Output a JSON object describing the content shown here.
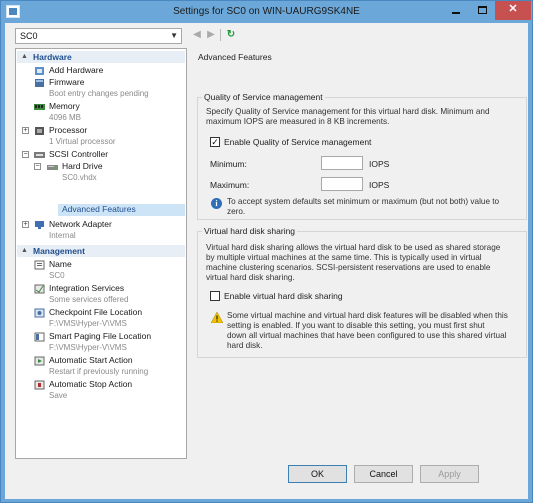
{
  "window": {
    "title": "Settings for SC0 on WIN-UAURG9SK4NE",
    "minimize_label": "—",
    "close_label": "✕"
  },
  "toolbar": {
    "vm_name": "SC0",
    "back_icon": "◀",
    "forward_icon": "▶",
    "refresh_icon": "↻"
  },
  "tree": {
    "hardware_header": "Hardware",
    "management_header": "Management",
    "hardware": [
      {
        "label": "Add Hardware",
        "sub": ""
      },
      {
        "label": "Firmware",
        "sub": "Boot entry changes pending"
      },
      {
        "label": "Memory",
        "sub": "4096 MB"
      },
      {
        "label": "Processor",
        "sub": "1 Virtual processor"
      },
      {
        "label": "SCSI Controller",
        "sub": ""
      },
      {
        "label": "Hard Drive",
        "sub": "SC0.vhdx"
      },
      {
        "label": "Advanced Features",
        "sub": ""
      },
      {
        "label": "Network Adapter",
        "sub": "Internal"
      }
    ],
    "management": [
      {
        "label": "Name",
        "sub": "SC0"
      },
      {
        "label": "Integration Services",
        "sub": "Some services offered"
      },
      {
        "label": "Checkpoint File Location",
        "sub": "F:\\VMS\\Hyper-V\\VMS"
      },
      {
        "label": "Smart Paging File Location",
        "sub": "F:\\VMS\\Hyper-V\\VMS"
      },
      {
        "label": "Automatic Start Action",
        "sub": "Restart if previously running"
      },
      {
        "label": "Automatic Stop Action",
        "sub": "Save"
      }
    ]
  },
  "panel": {
    "heading": "Advanced Features",
    "qos": {
      "legend": "Quality of Service management",
      "desc_line1": "Specify Quality of Service management for this virtual hard disk. Minimum and",
      "desc_line2": "maximum IOPS are measured in 8 KB increments.",
      "enable_label": "Enable Quality of Service management",
      "enable_checked": true,
      "minimum_label": "Minimum:",
      "minimum_value": "",
      "maximum_label": "Maximum:",
      "maximum_value": "",
      "unit": "IOPS",
      "info_line1": "To accept system defaults set minimum or maximum (but not both) value to",
      "info_line2": "zero."
    },
    "sharing": {
      "legend": "Virtual hard disk sharing",
      "desc_line1": "Virtual hard disk sharing allows the virtual hard disk to be used as shared storage",
      "desc_line2": "by multiple virtual machines at the same time. This is typically used in virtual",
      "desc_line3": "machine clustering scenarios. SCSI-persistent reservations are used to enable",
      "desc_line4": "virtual hard disk sharing.",
      "enable_label": "Enable virtual hard disk sharing",
      "enable_checked": false,
      "warn_line1": "Some virtual machine and virtual hard disk features will be disabled when this",
      "warn_line2": "setting is enabled. If you want to disable this setting, you must first shut",
      "warn_line3": "down all virtual machines that have been configured to use this shared virtual",
      "warn_line4": "hard disk."
    }
  },
  "buttons": {
    "ok": "OK",
    "cancel": "Cancel",
    "apply": "Apply"
  },
  "colors": {
    "title_bar": "#6ba7d8",
    "close_button": "#c75050",
    "section_header": "#1f4f8f",
    "selection": "#cde4f7",
    "info_icon": "#2e6fb8",
    "warning_icon": "#f2c200",
    "refresh_icon": "#1e9a3a"
  }
}
